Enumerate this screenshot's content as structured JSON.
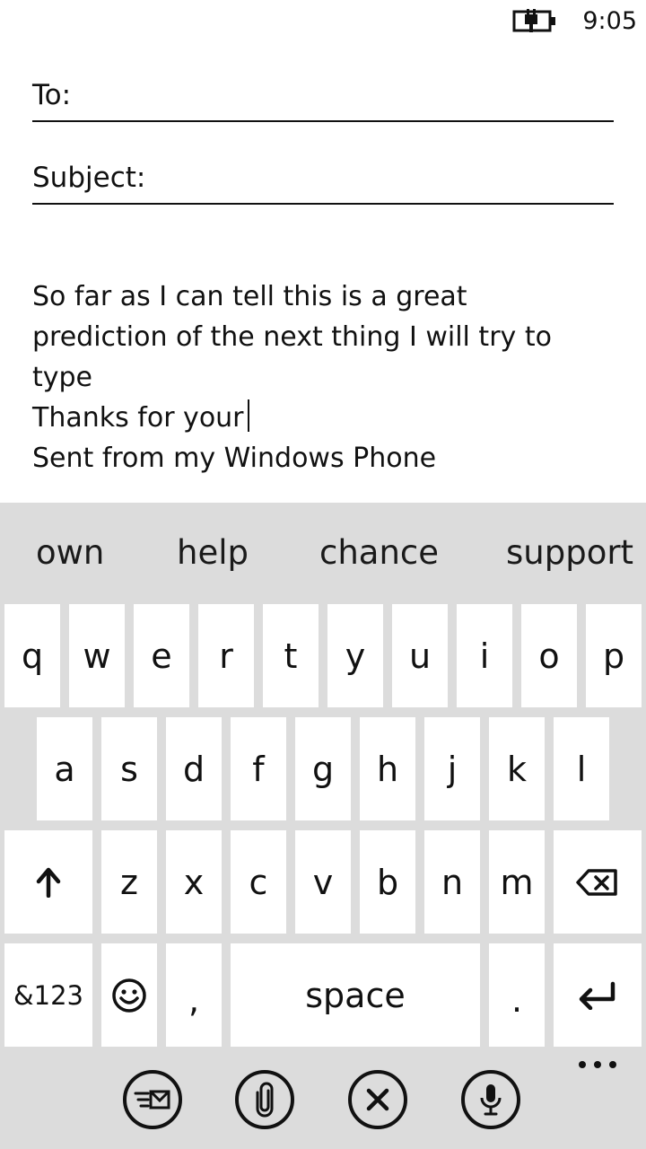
{
  "status_bar": {
    "time": "9:05",
    "battery_icon": "battery-charging-icon"
  },
  "compose": {
    "to_label": "To:",
    "subject_label": "Subject:",
    "body_lines": [
      "So far as I can tell this is a great",
      "prediction of the next thing I will try to",
      "type",
      "Thanks for your",
      "Sent from my Windows Phone"
    ]
  },
  "keyboard": {
    "suggestions": [
      "own",
      "help",
      "chance",
      "support"
    ],
    "row1": [
      "q",
      "w",
      "e",
      "r",
      "t",
      "y",
      "u",
      "i",
      "o",
      "p"
    ],
    "row2": [
      "a",
      "s",
      "d",
      "f",
      "g",
      "h",
      "j",
      "k",
      "l"
    ],
    "row3": [
      "z",
      "x",
      "c",
      "v",
      "b",
      "n",
      "m"
    ],
    "symbols_label": "&123",
    "comma_label": ",",
    "space_label": "space",
    "period_label": ".",
    "icons": {
      "shift": "shift-arrow-up-icon",
      "backspace": "backspace-icon",
      "emoji": "smiley-face-icon",
      "enter": "enter-return-icon"
    }
  },
  "app_bar": {
    "icons": [
      "send-mail-icon",
      "attachment-paperclip-icon",
      "discard-close-icon",
      "microphone-icon",
      "more-dots-icon"
    ]
  }
}
